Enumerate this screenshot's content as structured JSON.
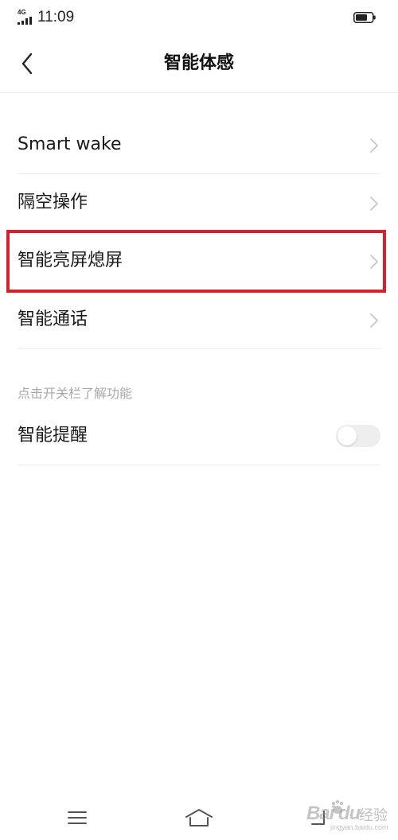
{
  "status_bar": {
    "network": "4G",
    "time": "11:09",
    "signal_icon": "signal-bars-icon",
    "battery_icon": "battery-icon",
    "battery_level": 0.7
  },
  "header": {
    "title": "智能体感",
    "back_icon": "chevron-left-icon"
  },
  "settings": {
    "items": [
      {
        "label": "Smart wake",
        "icon": "chevron-right-icon"
      },
      {
        "label": "隔空操作",
        "icon": "chevron-right-icon"
      },
      {
        "label": "智能亮屏熄屏",
        "icon": "chevron-right-icon",
        "highlighted": true
      },
      {
        "label": "智能通话",
        "icon": "chevron-right-icon"
      }
    ],
    "hint": "点击开关栏了解功能",
    "toggle_item": {
      "label": "智能提醒",
      "enabled": false
    }
  },
  "nav_bar": {
    "menu_icon": "menu-icon",
    "home_icon": "home-icon",
    "back_icon": "back-arrow-icon"
  },
  "watermark": {
    "logo": "Bai du",
    "text": "经验",
    "url": "jingyan.baidu.com"
  },
  "colors": {
    "highlight": "#d4212b",
    "hint_text": "#a8a8a8",
    "divider": "#ececec",
    "toggle_off": "#eeeeee"
  }
}
